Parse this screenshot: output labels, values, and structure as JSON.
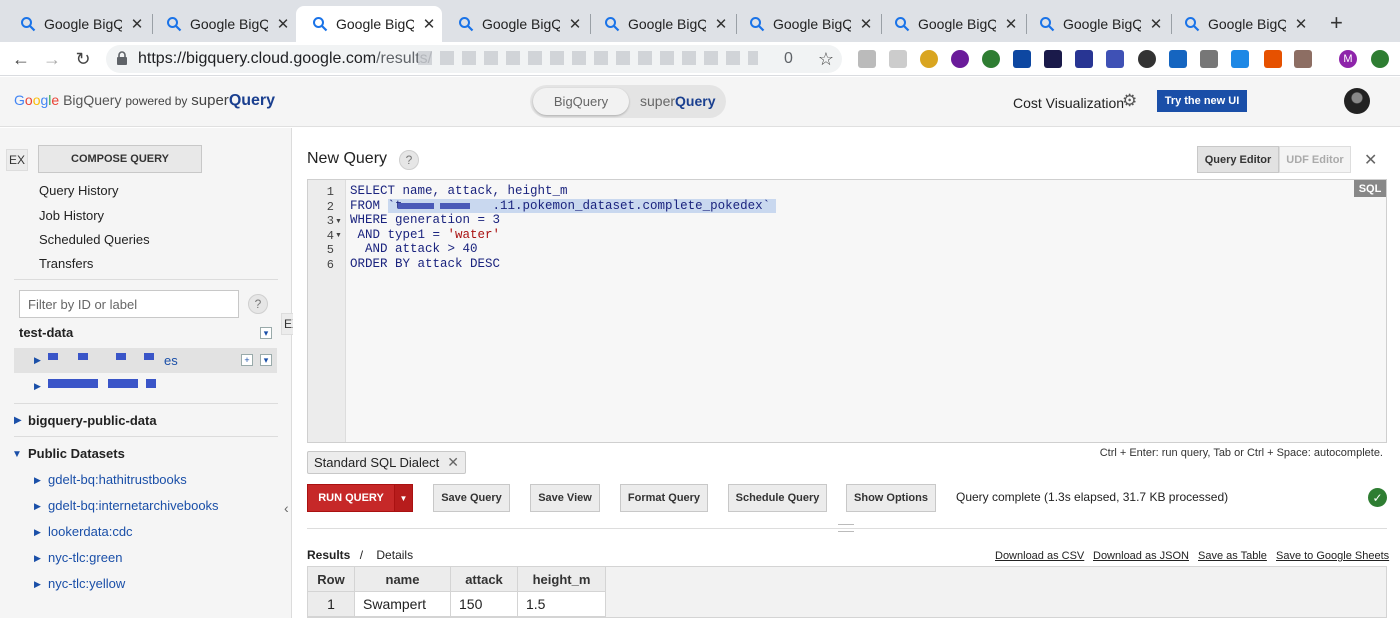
{
  "browser": {
    "tabs": [
      {
        "title": "Google BigQue",
        "active": false
      },
      {
        "title": "Google BigQue",
        "active": false
      },
      {
        "title": "Google BigQue",
        "active": true
      },
      {
        "title": "Google BigQue",
        "active": false
      },
      {
        "title": "Google BigQue",
        "active": false
      },
      {
        "title": "Google BigQue",
        "active": false
      },
      {
        "title": "Google BigQue",
        "active": false
      },
      {
        "title": "Google BigQue",
        "active": false
      },
      {
        "title": "Google BigQue",
        "active": false
      }
    ],
    "url_host": "https://bigquery.cloud.google.com",
    "url_path": "/results/",
    "url_tail": "0",
    "icons": [
      "back-arrow-icon",
      "forward-arrow-icon",
      "reload-icon",
      "lock-icon",
      "star-icon",
      "profile-M-icon"
    ]
  },
  "header": {
    "logo_bigquery": "BigQuery",
    "logo_powered": "powered by",
    "logo_super": "super",
    "logo_query": "Query",
    "switch_bigquery": "BigQuery",
    "switch_super": "super",
    "switch_query": "Query",
    "cost_visualization": "Cost Visualization",
    "try_new_ui": "Try the new UI"
  },
  "sidebar": {
    "ex_label": "EX",
    "compose_query": "COMPOSE QUERY",
    "links": [
      "Query History",
      "Job History",
      "Scheduled Queries",
      "Transfers"
    ],
    "filter_placeholder": "Filter by ID or label",
    "help": "?",
    "project": "test-data",
    "dataset1_suffix": "es",
    "bigquery_public_data": "bigquery-public-data",
    "public_datasets": "Public Datasets",
    "public_items": [
      "gdelt-bq:hathitrustbooks",
      "gdelt-bq:internetarchivebooks",
      "lookerdata:cdc",
      "nyc-tlc:green",
      "nyc-tlc:yellow"
    ]
  },
  "main": {
    "title": "New Query",
    "help": "?",
    "ex_label": "EX",
    "tab_query_editor": "Query Editor",
    "tab_udf_editor": "UDF Editor",
    "sql_badge": "SQL",
    "code": {
      "line_numbers": [
        "1",
        "2",
        "3",
        "4",
        "5",
        "6"
      ],
      "l1": "SELECT name, attack, height_m",
      "l2_kw": "FROM ",
      "l2_table": "`t.           .11.pokemon_dataset.complete_pokedex`",
      "l3_kw": "WHERE generation = ",
      "l3_num": "3",
      "l4_kw": " AND type1 = ",
      "l4_str": "'water'",
      "l5_kw": "  AND attack > ",
      "l5_num": "40",
      "l6": "ORDER BY attack DESC"
    },
    "dialect": "Standard SQL Dialect",
    "shortcut_hint": "Ctrl + Enter: run query, Tab or Ctrl + Space: autocomplete.",
    "buttons": {
      "run": "RUN QUERY",
      "save_query": "Save Query",
      "save_view": "Save View",
      "format_query": "Format Query",
      "schedule_query": "Schedule Query",
      "show_options": "Show Options"
    },
    "status": "Query complete (1.3s elapsed, 31.7 KB processed)",
    "results_tab": "Results",
    "results_sep": "/",
    "details_tab": "Details",
    "download_links": [
      "Download as CSV",
      "Download as JSON",
      "Save as Table",
      "Save to Google Sheets"
    ],
    "table": {
      "columns": [
        "Row",
        "name",
        "attack",
        "height_m"
      ],
      "rows": [
        [
          "1",
          "Swampert",
          "150",
          "1.5"
        ]
      ]
    }
  }
}
